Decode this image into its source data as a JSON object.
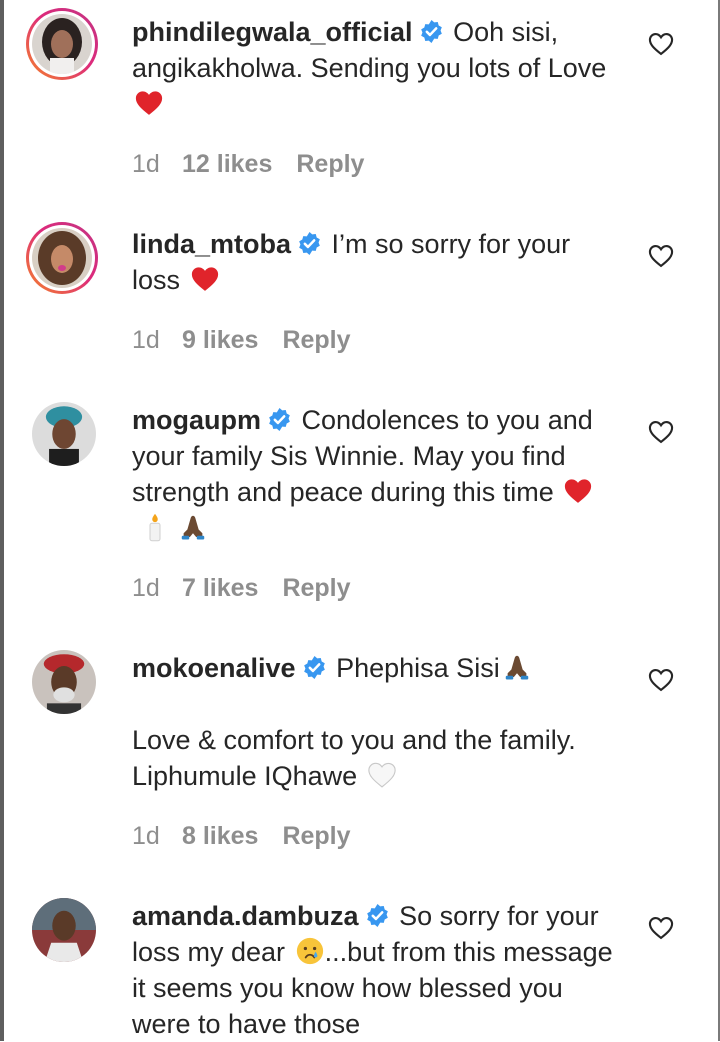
{
  "comments": [
    {
      "username": "phindilegwala_official",
      "text": "Ooh sisi, angikakholwa. Sending you lots of Love",
      "time": "1d",
      "likes": "12 likes",
      "reply": "Reply",
      "verified": true,
      "emojis": [
        "red-heart"
      ]
    },
    {
      "username": "linda_mtoba",
      "text": "I’m so sorry for your loss",
      "time": "1d",
      "likes": "9 likes",
      "reply": "Reply",
      "verified": true,
      "emojis": [
        "red-heart"
      ]
    },
    {
      "username": "mogaupm",
      "text": "Condolences to you and your family Sis Winnie. May you find strength and peace during this time",
      "time": "1d",
      "likes": "7 likes",
      "reply": "Reply",
      "verified": true,
      "emojis": [
        "red-heart",
        "candle",
        "folded-hands"
      ]
    },
    {
      "username": "mokoenalive",
      "text": "Phephisa Sisi",
      "text2": "Love & comfort to you and the family. Liphumule IQhawe",
      "time": "1d",
      "likes": "8 likes",
      "reply": "Reply",
      "verified": true,
      "emojis": [
        "folded-hands",
        "white-heart"
      ]
    },
    {
      "username": "amanda.dambuza",
      "text_before_emoji": "So sorry for your loss my dear",
      "text_after_emoji": "...but from this message it seems you know how blessed you were to have those",
      "verified": true,
      "emojis": [
        "crying-face"
      ]
    }
  ],
  "colors": {
    "text": "#262626",
    "meta": "#8e8e8e",
    "verified": "#3897f0",
    "heart": "#e0242b",
    "ring_start": "#f58529",
    "ring_end": "#c13584"
  }
}
